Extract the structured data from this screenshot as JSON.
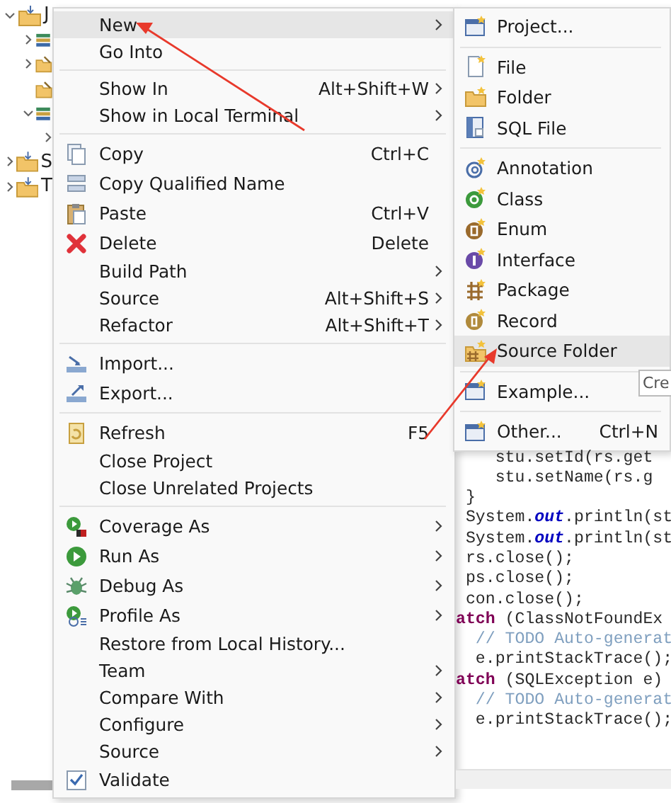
{
  "tree": {
    "items": [
      {
        "label": "J",
        "kind": "project",
        "expanded": true,
        "children": [
          {
            "kind": "library",
            "expanded": false
          },
          {
            "kind": "package",
            "expanded": false
          },
          {
            "kind": "package"
          },
          {
            "kind": "library",
            "expanded": true,
            "children": [
              {
                "expanded": false
              }
            ]
          }
        ]
      },
      {
        "label": "S",
        "kind": "project",
        "expanded": false
      },
      {
        "label": "T",
        "kind": "project",
        "expanded": false
      }
    ]
  },
  "menu": {
    "groups": [
      [
        {
          "label": "New",
          "submenu": true,
          "selected": true
        },
        {
          "label": "Go Into",
          "submenu": false,
          "selected": false
        }
      ],
      [
        {
          "label": "Show In",
          "shortcut": "Alt+Shift+W",
          "submenu": true,
          "selected": false
        },
        {
          "label": "Show in Local Terminal",
          "submenu": true,
          "selected": false
        }
      ],
      [
        {
          "label": "Copy",
          "kind": "copy",
          "shortcut": "Ctrl+C",
          "submenu": false,
          "selected": false
        },
        {
          "label": "Copy Qualified Name",
          "kind": "copy-name",
          "submenu": false,
          "selected": false
        },
        {
          "label": "Paste",
          "kind": "paste",
          "shortcut": "Ctrl+V",
          "submenu": false,
          "selected": false
        },
        {
          "label": "Delete",
          "kind": "delete",
          "shortcut": "Delete",
          "submenu": false,
          "selected": false
        },
        {
          "label": "Build Path",
          "submenu": true,
          "selected": false
        },
        {
          "label": "Source",
          "shortcut": "Alt+Shift+S",
          "submenu": true,
          "selected": false
        },
        {
          "label": "Refactor",
          "shortcut": "Alt+Shift+T",
          "submenu": true,
          "selected": false
        }
      ],
      [
        {
          "label": "Import...",
          "kind": "import",
          "submenu": false,
          "selected": false
        },
        {
          "label": "Export...",
          "kind": "export",
          "submenu": false,
          "selected": false
        }
      ],
      [
        {
          "label": "Refresh",
          "kind": "refresh",
          "shortcut": "F5",
          "submenu": false,
          "selected": false
        },
        {
          "label": "Close Project",
          "submenu": false,
          "selected": false
        },
        {
          "label": "Close Unrelated Projects",
          "submenu": false,
          "selected": false
        }
      ],
      [
        {
          "label": "Coverage As",
          "kind": "coverage",
          "submenu": true,
          "selected": false
        },
        {
          "label": "Run As",
          "kind": "run",
          "submenu": true,
          "selected": false
        },
        {
          "label": "Debug As",
          "kind": "debug",
          "submenu": true,
          "selected": false
        },
        {
          "label": "Profile As",
          "kind": "profile",
          "submenu": true,
          "selected": false
        },
        {
          "label": "Restore from Local History...",
          "submenu": false,
          "selected": false
        },
        {
          "label": "Team",
          "submenu": true,
          "selected": false
        },
        {
          "label": "Compare With",
          "submenu": true,
          "selected": false
        },
        {
          "label": "Configure",
          "submenu": true,
          "selected": false
        },
        {
          "label": "Source",
          "submenu": true,
          "selected": false
        },
        {
          "label": "Validate",
          "kind": "check",
          "checked": true,
          "submenu": false,
          "selected": false
        }
      ]
    ]
  },
  "submenu": {
    "groups": [
      [
        {
          "label": "Project...",
          "kind": "project",
          "selected": false
        }
      ],
      [
        {
          "label": "File",
          "kind": "file",
          "selected": false
        },
        {
          "label": "Folder",
          "kind": "folder",
          "selected": false
        },
        {
          "label": "SQL File",
          "kind": "sql",
          "selected": false
        }
      ],
      [
        {
          "label": "Annotation",
          "kind": "annotation",
          "selected": false
        },
        {
          "label": "Class",
          "kind": "class",
          "selected": false
        },
        {
          "label": "Enum",
          "kind": "enum",
          "selected": false
        },
        {
          "label": "Interface",
          "kind": "interface",
          "selected": false
        },
        {
          "label": "Package",
          "kind": "package",
          "selected": false
        },
        {
          "label": "Record",
          "kind": "record",
          "selected": false
        },
        {
          "label": "Source Folder",
          "kind": "source-folder",
          "selected": true
        }
      ],
      [
        {
          "label": "Example...",
          "kind": "example",
          "selected": false
        }
      ],
      [
        {
          "label": "Other...",
          "kind": "other",
          "shortcut": "Ctrl+N",
          "selected": false
        }
      ]
    ]
  },
  "tooltip": {
    "text": "Cre"
  },
  "code": {
    "lines": [
      [
        {
          "text": "    stu.setId(rs.get",
          "kind": "plain"
        }
      ],
      [
        {
          "text": "    stu.setName(rs.g",
          "kind": "plain"
        }
      ],
      [
        {
          "text": " }",
          "kind": "plain"
        }
      ],
      [
        {
          "text": " System.",
          "kind": "plain"
        },
        {
          "text": "out",
          "kind": "field"
        },
        {
          "text": ".println(st",
          "kind": "plain"
        }
      ],
      [
        {
          "text": " System.",
          "kind": "plain"
        },
        {
          "text": "out",
          "kind": "field"
        },
        {
          "text": ".println(st",
          "kind": "plain"
        }
      ],
      [
        {
          "text": " rs.close();",
          "kind": "plain"
        }
      ],
      [
        {
          "text": " ps.close();",
          "kind": "plain"
        }
      ],
      [
        {
          "text": " con.close();",
          "kind": "plain"
        }
      ],
      [
        {
          "text": "atch",
          "kind": "keyword"
        },
        {
          "text": " (ClassNotFoundEx",
          "kind": "plain"
        }
      ],
      [
        {
          "text": "  // TODO Auto-generat",
          "kind": "comment"
        }
      ],
      [
        {
          "text": "  e.printStackTrace();",
          "kind": "plain"
        }
      ],
      [
        {
          "text": "atch",
          "kind": "keyword"
        },
        {
          "text": " (SQLException e)",
          "kind": "plain"
        }
      ],
      [
        {
          "text": "  // TODO Auto-generat",
          "kind": "comment"
        }
      ],
      [
        {
          "text": "  e.printStackTrace();",
          "kind": "plain"
        }
      ]
    ]
  }
}
